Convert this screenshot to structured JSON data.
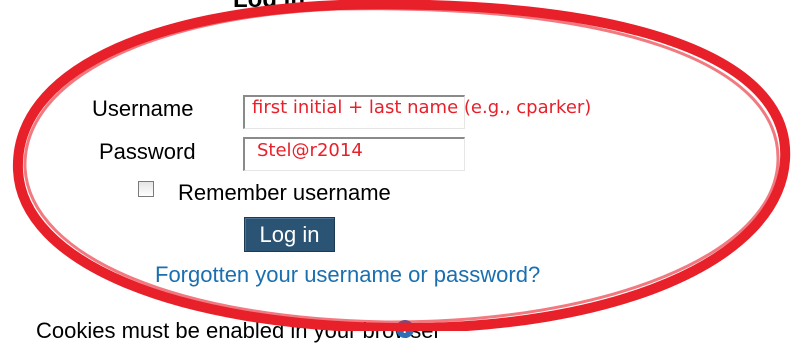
{
  "page": {
    "heading": "Log in"
  },
  "login_form": {
    "username_label": "Username",
    "password_label": "Password",
    "remember_label": "Remember username",
    "remember_checked": false,
    "login_button_label": "Log in",
    "forgot_link_text": "Forgotten your username or password?"
  },
  "annotations": {
    "username_hint": "first initial + last name (e.g., cparker)",
    "password_hint": "Stel@r2014",
    "color": "#e8202a"
  },
  "footer": {
    "cookies_text": "Cookies must be enabled in your browser",
    "help_icon": "help-icon"
  },
  "colors": {
    "button_bg": "#2b5374",
    "link": "#1a6fb0",
    "annotation_red": "#e8202a"
  }
}
